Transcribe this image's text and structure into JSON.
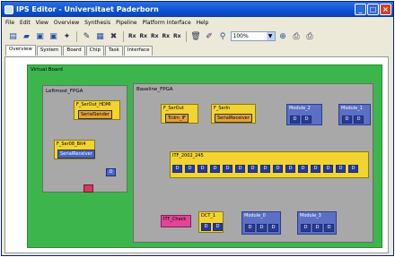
{
  "window": {
    "title": "IPS Editor - Universitaet Paderborn"
  },
  "menu": [
    "File",
    "Edit",
    "View",
    "Overview",
    "Synthesis",
    "Pipeline",
    "Platform Interface",
    "Help"
  ],
  "toolbar": {
    "labels": [
      "Rx",
      "Rx",
      "Rx",
      "Rx",
      "Rx"
    ],
    "zoom_value": "100%"
  },
  "tabs": [
    "Overview",
    "System",
    "Board",
    "Chip",
    "Task",
    "Interface"
  ],
  "active_tab": 0,
  "board": {
    "label": "Virtual Board"
  },
  "fpga_left": {
    "label": "Leftmost_FPGA",
    "comp1": {
      "title": "F_SerOut_HDMI",
      "inner": "SerialSender"
    },
    "comp2": {
      "title": "F_Ser08_Bit4",
      "inner": "SerialReceiver"
    }
  },
  "fpga_right": {
    "label": "Baseline_FPGA",
    "ser_out": {
      "title": "F_SerOut",
      "inner": "Tcdm_IF"
    },
    "ser_in": {
      "title": "F_SerIn",
      "inner": "SerialReceiver"
    },
    "module2": {
      "title": "Module_2"
    },
    "module1": {
      "title": "Module_1"
    },
    "bus": {
      "title": "ITF_2002_245",
      "ports": [
        "D",
        "D",
        "D",
        "D",
        "D",
        "D",
        "D",
        "D",
        "D",
        "D",
        "D",
        "D",
        "D",
        "D",
        "D"
      ]
    },
    "mem_check": {
      "title": "ITF_Check"
    },
    "dct1": {
      "title": "DCT_1"
    },
    "module0": {
      "title": "Module_0"
    },
    "module3": {
      "title": "Module_3"
    }
  },
  "colors": {
    "titlebar": "#0a50d6",
    "board": "#3cb64c",
    "fpga": "#a8a8a8",
    "component": "#f2d431",
    "module": "#5b6fc4"
  }
}
